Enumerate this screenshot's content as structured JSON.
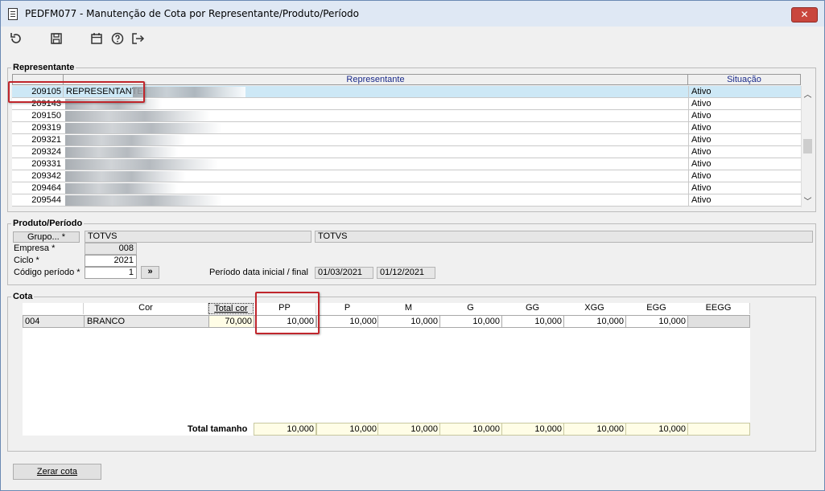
{
  "window": {
    "title": "PEDFM077 - Manutenção de Cota por Representante/Produto/Período",
    "close": "✕"
  },
  "toolbar": {
    "icons": [
      "refresh-icon",
      "save-icon",
      "calendar-icon",
      "help-icon",
      "exit-icon"
    ]
  },
  "representante": {
    "title": "Representante",
    "col_name": "Representante",
    "col_situacao": "Situação",
    "rows": [
      {
        "code": "209105",
        "name": "REPRESENTANTE",
        "situacao": "Ativo"
      },
      {
        "code": "209143",
        "name": "",
        "situacao": "Ativo"
      },
      {
        "code": "209150",
        "name": "",
        "situacao": "Ativo"
      },
      {
        "code": "209319",
        "name": "",
        "situacao": "Ativo"
      },
      {
        "code": "209321",
        "name": "",
        "situacao": "Ativo"
      },
      {
        "code": "209324",
        "name": "",
        "situacao": "Ativo"
      },
      {
        "code": "209331",
        "name": "",
        "situacao": "Ativo"
      },
      {
        "code": "209342",
        "name": "",
        "situacao": "Ativo"
      },
      {
        "code": "209464",
        "name": "",
        "situacao": "Ativo"
      },
      {
        "code": "209544",
        "name": "",
        "situacao": "Ativo"
      }
    ]
  },
  "produto": {
    "title": "Produto/Período",
    "grupo_label": "Grupo... *",
    "grupo_code": "TOTVS",
    "grupo_desc": "TOTVS",
    "empresa_label": "Empresa *",
    "empresa_value": "008",
    "ciclo_label": "Ciclo *",
    "ciclo_value": "2021",
    "codigo_label": "Código período *",
    "codigo_value": "1",
    "codigo_btn": "»",
    "periodo_label": "Período data inicial / final",
    "data_inicial": "01/03/2021",
    "data_final": "01/12/2021"
  },
  "cota": {
    "title": "Cota",
    "col_cor": "Cor",
    "col_total_cor": "Total cor",
    "sizes": [
      "PP",
      "P",
      "M",
      "G",
      "GG",
      "XGG",
      "EGG",
      "EEGG"
    ],
    "row": {
      "code": "004",
      "cor": "BRANCO",
      "total": "70,000",
      "values": [
        "10,000",
        "10,000",
        "10,000",
        "10,000",
        "10,000",
        "10,000",
        "10,000",
        ""
      ]
    },
    "total_label": "Total tamanho",
    "totals": [
      "10,000",
      "10,000",
      "10,000",
      "10,000",
      "10,000",
      "10,000",
      "10,000",
      ""
    ]
  },
  "footer": {
    "zerar_label": "Zerar cota"
  }
}
